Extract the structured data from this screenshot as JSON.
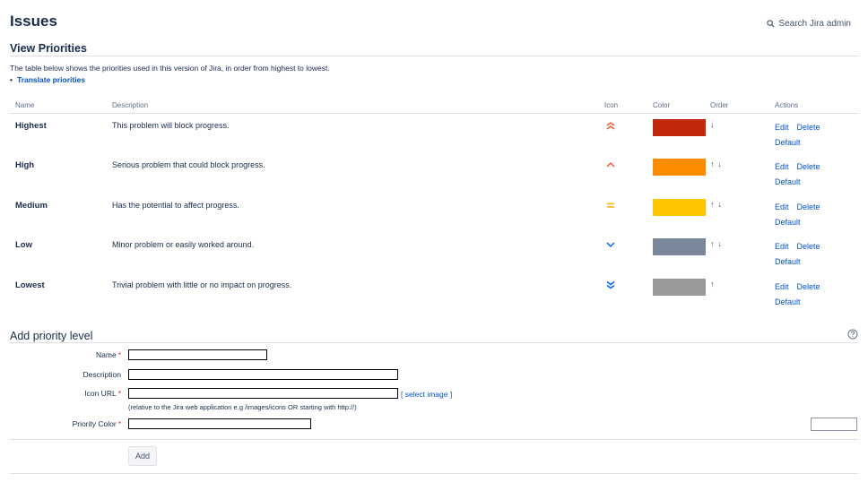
{
  "header": {
    "title": "Issues",
    "search_label": "Search Jira admin"
  },
  "view": {
    "title": "View Priorities",
    "intro": "The table below shows the priorities used in this version of Jira, in order from highest to lowest.",
    "translate_bullet": "•",
    "translate_link": "Translate priorities"
  },
  "table": {
    "headers": {
      "name": "Name",
      "description": "Description",
      "icon": "Icon",
      "color": "Color",
      "order": "Order",
      "actions": "Actions"
    },
    "rows": [
      {
        "name": "Highest",
        "description": "This problem will block progress.",
        "icon": "highest-priority-icon",
        "color": "#c0290b",
        "up": "",
        "down": "↓",
        "edit": "Edit",
        "delete": "Delete",
        "default": "Default"
      },
      {
        "name": "High",
        "description": "Serious problem that could block progress.",
        "icon": "high-priority-icon",
        "color": "#ff8b00",
        "up": "↑",
        "down": "↓",
        "edit": "Edit",
        "delete": "Delete",
        "default": "Default"
      },
      {
        "name": "Medium",
        "description": "Has the potential to affect progress.",
        "icon": "medium-priority-icon",
        "color": "#ffc400",
        "up": "↑",
        "down": "↓",
        "edit": "Edit",
        "delete": "Delete",
        "default": "Default"
      },
      {
        "name": "Low",
        "description": "Minor problem or easily worked around.",
        "icon": "low-priority-icon",
        "color": "#7a869a",
        "up": "↑",
        "down": "↓",
        "edit": "Edit",
        "delete": "Delete",
        "default": "Default"
      },
      {
        "name": "Lowest",
        "description": "Trivial problem with little or no impact on progress.",
        "icon": "lowest-priority-icon",
        "color": "#999999",
        "up": "↑",
        "down": "",
        "edit": "Edit",
        "delete": "Delete",
        "default": "Default"
      }
    ]
  },
  "add": {
    "title": "Add priority level",
    "required_marker": "*",
    "name_label": "Name",
    "name_value": "",
    "description_label": "Description",
    "description_value": "",
    "icon_url_label": "Icon URL",
    "icon_url_value": "",
    "select_image_open": "[",
    "select_image": "select image",
    "select_image_close": "]",
    "icon_hint": "(relative to the Jira web application e.g /images/icons OR starting with http://)",
    "color_label": "Priority Color",
    "color_value": "",
    "add_button": "Add"
  },
  "colors": {
    "link": "#0052cc",
    "required": "#de350b",
    "text": "#172b4d"
  }
}
